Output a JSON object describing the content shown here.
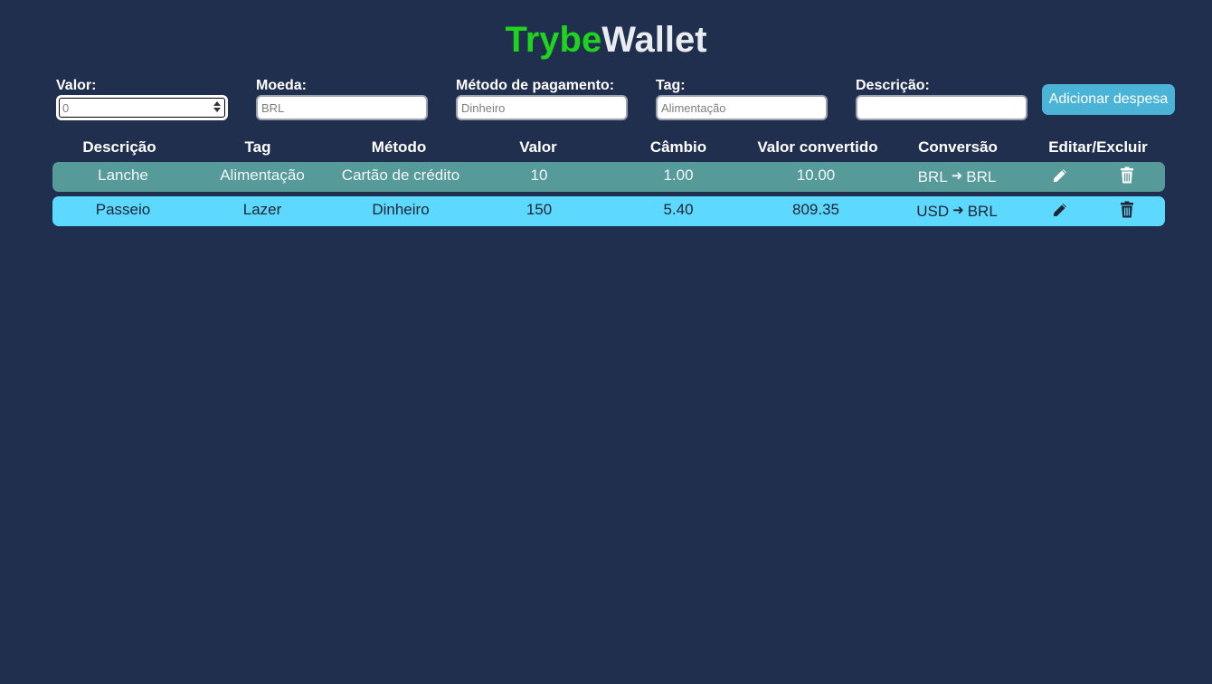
{
  "app": {
    "title_part1": "Trybe",
    "title_part2": "Wallet",
    "accent_color": "#1ed41e",
    "background_color": "#1f2f4d"
  },
  "form": {
    "valor": {
      "label": "Valor:",
      "placeholder": "0"
    },
    "moeda": {
      "label": "Moeda:",
      "placeholder": "BRL"
    },
    "metodo": {
      "label": "Método de pagamento:",
      "placeholder": "Dinheiro"
    },
    "tag": {
      "label": "Tag:",
      "placeholder": "Alimentação"
    },
    "descricao": {
      "label": "Descrição:",
      "placeholder": ""
    },
    "add_button": "Adicionar despesa"
  },
  "table": {
    "headers": [
      "Descrição",
      "Tag",
      "Método",
      "Valor",
      "Câmbio",
      "Valor convertido",
      "Conversão",
      "Editar/Excluir"
    ],
    "rows": [
      {
        "descricao": "Lanche",
        "tag": "Alimentação",
        "metodo": "Cartão de crédito",
        "valor": "10",
        "cambio": "1.00",
        "convertido": "10.00",
        "from": "BRL",
        "to": "BRL",
        "edit_icon": "pencil-icon",
        "delete_icon": "trash-icon"
      },
      {
        "descricao": "Passeio",
        "tag": "Lazer",
        "metodo": "Dinheiro",
        "valor": "150",
        "cambio": "5.40",
        "convertido": "809.35",
        "from": "USD",
        "to": "BRL",
        "edit_icon": "pencil-icon",
        "delete_icon": "trash-icon"
      }
    ]
  }
}
